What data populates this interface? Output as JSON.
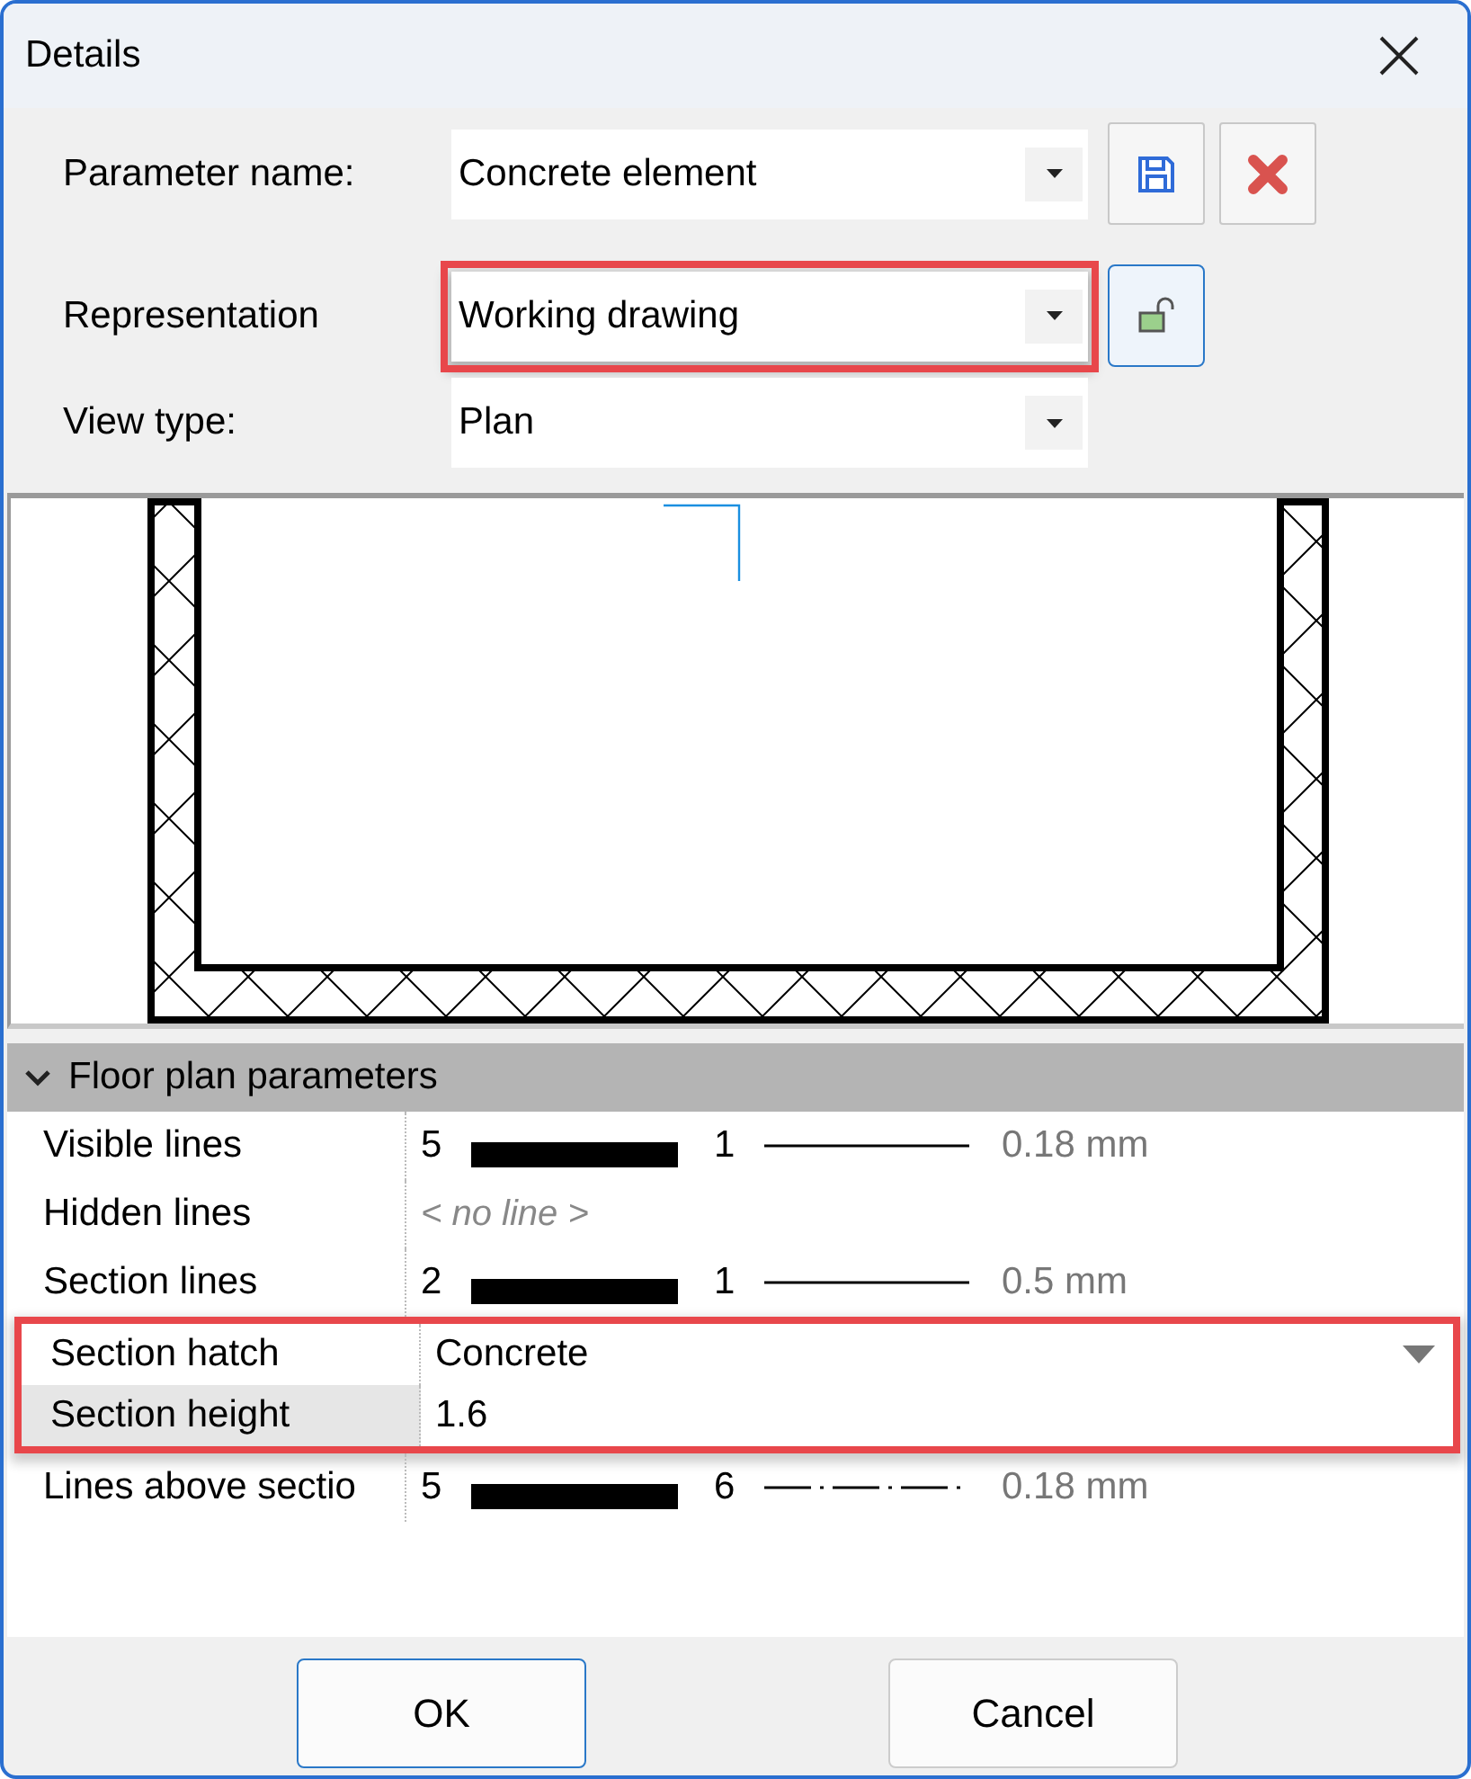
{
  "window": {
    "title": "Details"
  },
  "fields": [
    {
      "label": "Parameter name:",
      "value": "Concrete element",
      "highlighted": false,
      "tools": [
        {
          "kind": "save",
          "pressed": false
        },
        {
          "kind": "delete",
          "pressed": false
        }
      ]
    },
    {
      "label": "Representation",
      "value": "Working drawing",
      "highlighted": true,
      "tools": [
        {
          "kind": "lock",
          "pressed": true
        }
      ]
    },
    {
      "label": "View type:",
      "value": "Plan",
      "highlighted": false
    }
  ],
  "section": {
    "title": "Floor plan parameters",
    "expanded": true,
    "rows": [
      {
        "kind": "line",
        "label": "Visible lines",
        "pen": "5",
        "line": "1",
        "dash_dot": false,
        "width": "0.18 mm",
        "highlighted": false,
        "selected": false
      },
      {
        "kind": "none",
        "label": "Hidden lines",
        "value": "< no line >",
        "highlighted": false,
        "selected": false
      },
      {
        "kind": "line",
        "label": "Section lines",
        "pen": "2",
        "line": "1",
        "dash_dot": false,
        "width": "0.5 mm",
        "highlighted": false,
        "selected": false
      },
      {
        "kind": "combo",
        "label": "Section hatch",
        "value": "Concrete",
        "highlighted": true,
        "selected": false
      },
      {
        "kind": "text",
        "label": "Section height",
        "value": "1.6",
        "highlighted": true,
        "selected": true
      },
      {
        "kind": "line",
        "label": "Lines above sectio",
        "pen": "5",
        "line": "6",
        "dash_dot": true,
        "width": "0.18 mm",
        "highlighted": false,
        "selected": false
      }
    ]
  },
  "buttons": [
    {
      "label": "OK",
      "default": true
    },
    {
      "label": "Cancel",
      "default": false
    }
  ]
}
